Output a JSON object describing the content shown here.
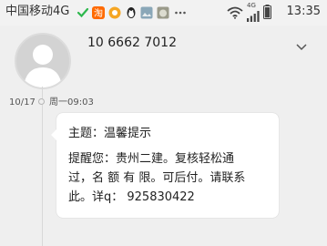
{
  "status_bar": {
    "carrier": "中国移动4G",
    "network": "4G",
    "time": "13:35",
    "icons": [
      "wechat-icon",
      "taobao-icon",
      "qq-icon",
      "app-icon",
      "app-icon",
      "more-icon",
      "wifi-icon",
      "signal-icon",
      "battery-icon"
    ]
  },
  "header": {
    "phone_number": "10 6662 7012"
  },
  "timeline": {
    "date": "10/17",
    "weekday_time": "周一09:03"
  },
  "message": {
    "subject": "主题：温馨提示",
    "body_lines": [
      "提醒您：贵州二建。复核轻松通",
      "过，名 额 有 限。可后付。请联系",
      "此。详q：  925830422"
    ]
  },
  "colors": {
    "background": "#efefef",
    "bubble": "#ffffff",
    "text": "#222222"
  }
}
